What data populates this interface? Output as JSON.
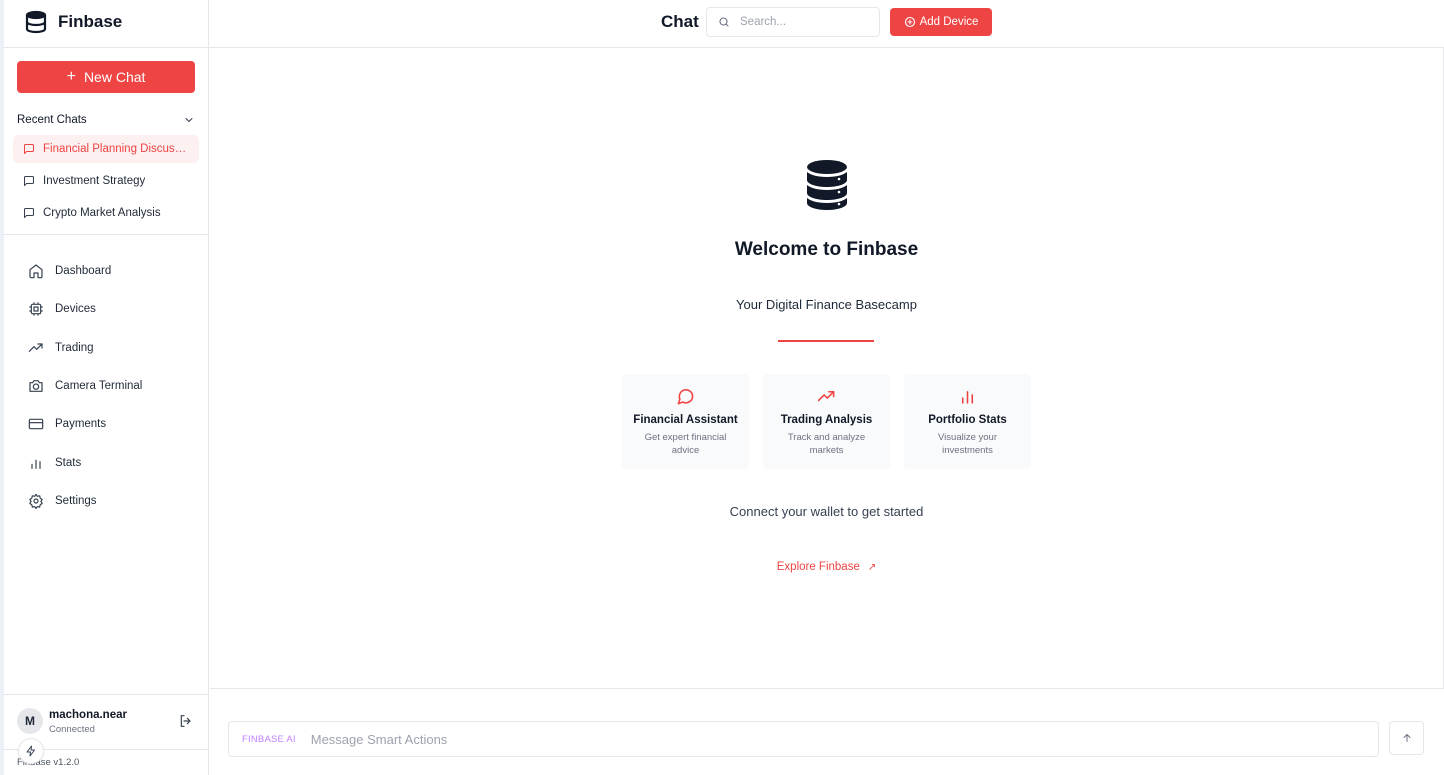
{
  "colors": {
    "accent": "#ef4444",
    "accent_soft": "#fdf0f0",
    "muted_text": "#6b7280",
    "border": "#e5e7eb",
    "ai_tag": "#c084fc"
  },
  "sidebar": {
    "brand": "Finbase",
    "brand_icon": "database-icon",
    "new_chat_label": "New Chat",
    "recent_chats_label": "Recent Chats",
    "recent_chats": [
      {
        "label": "Financial Planning Discussion",
        "active": true
      },
      {
        "label": "Investment Strategy",
        "active": false
      },
      {
        "label": "Crypto Market Analysis",
        "active": false
      }
    ],
    "nav": [
      {
        "label": "Dashboard",
        "icon": "home-icon"
      },
      {
        "label": "Devices",
        "icon": "cpu-icon"
      },
      {
        "label": "Trading",
        "icon": "trending-up-icon"
      },
      {
        "label": "Camera Terminal",
        "icon": "camera-icon"
      },
      {
        "label": "Payments",
        "icon": "credit-card-icon"
      },
      {
        "label": "Stats",
        "icon": "bar-chart-icon"
      },
      {
        "label": "Settings",
        "icon": "gear-icon"
      }
    ],
    "user": {
      "initial": "M",
      "name": "machona.near",
      "status": "Connected"
    },
    "version": "Finbase v1.2.0"
  },
  "header": {
    "title": "Chat",
    "search_placeholder": "Search...",
    "add_device_label": "Add Device"
  },
  "main": {
    "welcome_title": "Welcome to Finbase",
    "subtitle": "Your Digital Finance Basecamp",
    "cards": [
      {
        "title": "Financial Assistant",
        "description": "Get expert financial advice",
        "icon": "message-circle-icon"
      },
      {
        "title": "Trading Analysis",
        "description": "Track and analyze markets",
        "icon": "trending-up-icon"
      },
      {
        "title": "Portfolio Stats",
        "description": "Visualize your investments",
        "icon": "bar-chart-icon"
      }
    ],
    "connect_text": "Connect your wallet to get started",
    "explore_label": "Explore Finbase"
  },
  "composer": {
    "tag": "FINBASE AI",
    "placeholder": "Message Smart Actions"
  }
}
